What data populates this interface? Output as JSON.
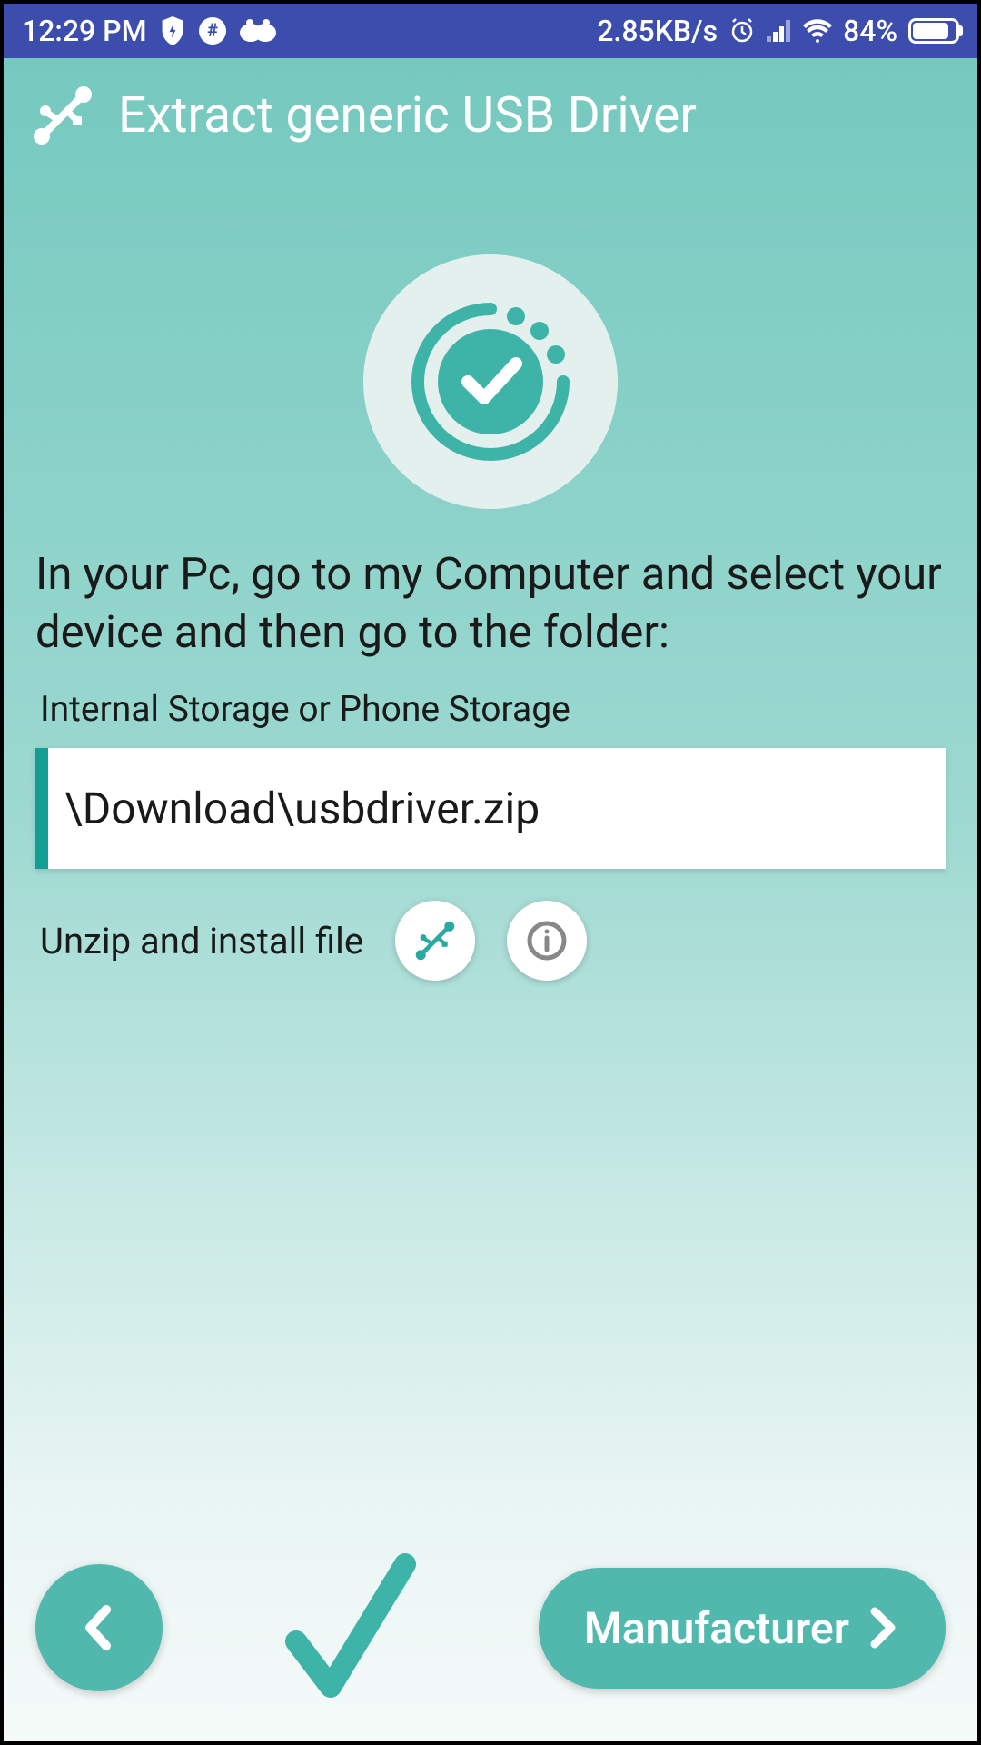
{
  "statusBar": {
    "time": "12:29 PM",
    "speed": "2.85KB/s",
    "battery": "84%"
  },
  "header": {
    "title": "Extract generic USB Driver"
  },
  "content": {
    "instruction": "In your Pc, go to my Computer and select your device and then go to the folder:",
    "storageLabel": "Internal Storage or Phone Storage",
    "path": "\\Download\\usbdriver.zip",
    "actionLabel": "Unzip and install file"
  },
  "footer": {
    "nextLabel": "Manufacturer"
  },
  "colors": {
    "statusBar": "#3c4dad",
    "primary": "#50b8ad",
    "accent": "#139e94"
  }
}
